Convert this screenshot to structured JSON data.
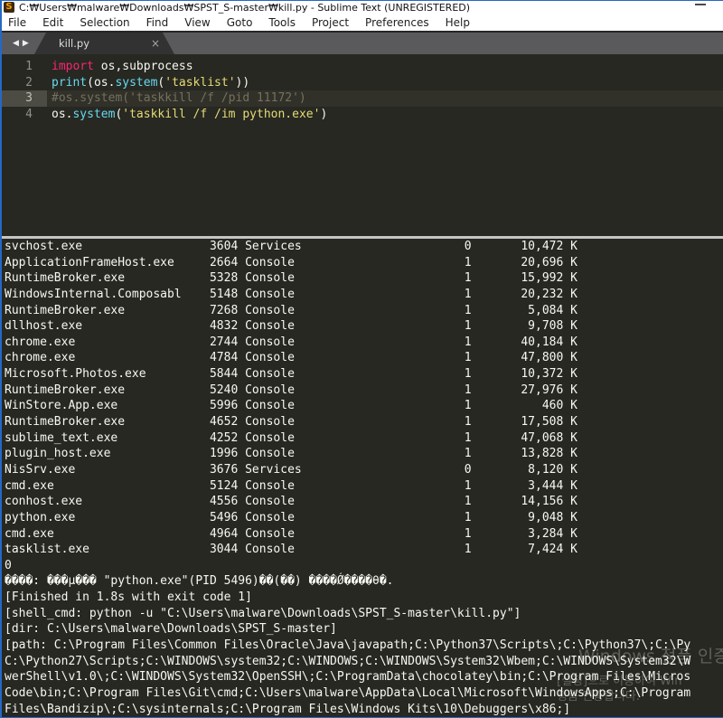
{
  "window": {
    "title": "C:₩Users₩malware₩Downloads₩SPST_S-master₩kill.py - Sublime Text (UNREGISTERED)",
    "app_icon": "S"
  },
  "menu": {
    "items": [
      "File",
      "Edit",
      "Selection",
      "Find",
      "View",
      "Goto",
      "Tools",
      "Project",
      "Preferences",
      "Help"
    ]
  },
  "tabbar": {
    "prev_icon": "◀",
    "next_icon": "▶",
    "tab": {
      "label": "kill.py",
      "close_icon": "×"
    }
  },
  "editor": {
    "lines": [
      {
        "number": "1",
        "highlight": false,
        "tokens": [
          {
            "t": "import",
            "c": "kw"
          },
          {
            "t": " os,subprocess",
            "c": "plain"
          }
        ]
      },
      {
        "number": "2",
        "highlight": false,
        "tokens": [
          {
            "t": "print",
            "c": "fn"
          },
          {
            "t": "(os.",
            "c": "plain"
          },
          {
            "t": "system",
            "c": "fn"
          },
          {
            "t": "(",
            "c": "plain"
          },
          {
            "t": "'tasklist'",
            "c": "str"
          },
          {
            "t": "))",
            "c": "plain"
          }
        ]
      },
      {
        "number": "3",
        "highlight": true,
        "tokens": [
          {
            "t": "#os.system('taskkill /f /pid 11172')",
            "c": "cmt"
          }
        ]
      },
      {
        "number": "4",
        "highlight": false,
        "tokens": [
          {
            "t": "os.",
            "c": "plain"
          },
          {
            "t": "system",
            "c": "fn"
          },
          {
            "t": "(",
            "c": "plain"
          },
          {
            "t": "'taskkill /f /im python.exe'",
            "c": "str"
          },
          {
            "t": ")",
            "c": "plain"
          }
        ]
      }
    ]
  },
  "console": {
    "processes": [
      {
        "name": "svchost.exe",
        "pid": "3604",
        "session": "Services",
        "session_no": "0",
        "mem": "10,472 K"
      },
      {
        "name": "ApplicationFrameHost.exe",
        "pid": "2664",
        "session": "Console",
        "session_no": "1",
        "mem": "20,696 K"
      },
      {
        "name": "RuntimeBroker.exe",
        "pid": "5328",
        "session": "Console",
        "session_no": "1",
        "mem": "15,992 K"
      },
      {
        "name": "WindowsInternal.Composabl",
        "pid": "5148",
        "session": "Console",
        "session_no": "1",
        "mem": "20,232 K"
      },
      {
        "name": "RuntimeBroker.exe",
        "pid": "7268",
        "session": "Console",
        "session_no": "1",
        "mem": "5,084 K"
      },
      {
        "name": "dllhost.exe",
        "pid": "4832",
        "session": "Console",
        "session_no": "1",
        "mem": "9,708 K"
      },
      {
        "name": "chrome.exe",
        "pid": "2744",
        "session": "Console",
        "session_no": "1",
        "mem": "40,184 K"
      },
      {
        "name": "chrome.exe",
        "pid": "4784",
        "session": "Console",
        "session_no": "1",
        "mem": "47,800 K"
      },
      {
        "name": "Microsoft.Photos.exe",
        "pid": "5844",
        "session": "Console",
        "session_no": "1",
        "mem": "10,372 K"
      },
      {
        "name": "RuntimeBroker.exe",
        "pid": "5240",
        "session": "Console",
        "session_no": "1",
        "mem": "27,976 K"
      },
      {
        "name": "WinStore.App.exe",
        "pid": "5996",
        "session": "Console",
        "session_no": "1",
        "mem": "460 K"
      },
      {
        "name": "RuntimeBroker.exe",
        "pid": "4652",
        "session": "Console",
        "session_no": "1",
        "mem": "17,508 K"
      },
      {
        "name": "sublime_text.exe",
        "pid": "4252",
        "session": "Console",
        "session_no": "1",
        "mem": "47,068 K"
      },
      {
        "name": "plugin_host.exe",
        "pid": "1996",
        "session": "Console",
        "session_no": "1",
        "mem": "13,828 K"
      },
      {
        "name": "NisSrv.exe",
        "pid": "3676",
        "session": "Services",
        "session_no": "0",
        "mem": "8,120 K"
      },
      {
        "name": "cmd.exe",
        "pid": "5124",
        "session": "Console",
        "session_no": "1",
        "mem": "3,444 K"
      },
      {
        "name": "conhost.exe",
        "pid": "4556",
        "session": "Console",
        "session_no": "1",
        "mem": "14,156 K"
      },
      {
        "name": "python.exe",
        "pid": "5496",
        "session": "Console",
        "session_no": "1",
        "mem": "9,048 K"
      },
      {
        "name": "cmd.exe",
        "pid": "4964",
        "session": "Console",
        "session_no": "1",
        "mem": "3,284 K"
      },
      {
        "name": "tasklist.exe",
        "pid": "3044",
        "session": "Console",
        "session_no": "1",
        "mem": "7,424 K"
      }
    ],
    "tail_lines": [
      "0",
      "����: ���µ��� \"python.exe\"(PID 5496)��(��) ����Ǿ����θ�.",
      "[Finished in 1.8s with exit code 1]",
      "[shell_cmd: python -u \"C:\\Users\\malware\\Downloads\\SPST_S-master\\kill.py\"]",
      "[dir: C:\\Users\\malware\\Downloads\\SPST_S-master]",
      "[path: C:\\Program Files\\Common Files\\Oracle\\Java\\javapath;C:\\Python37\\Scripts\\;C:\\Python37\\;C:\\Py",
      "C:\\Python27\\Scripts;C:\\WINDOWS\\system32;C:\\WINDOWS;C:\\WINDOWS\\System32\\Wbem;C:\\WINDOWS\\System32\\W",
      "werShell\\v1.0\\;C:\\WINDOWS\\System32\\OpenSSH\\;C:\\ProgramData\\chocolatey\\bin;C:\\Program Files\\Micros",
      "Code\\bin;C:\\Program Files\\Git\\cmd;C:\\Users\\malware\\AppData\\Local\\Microsoft\\WindowsApps;C:\\Program",
      "Files\\Bandizip\\;C:\\sysinternals;C:\\Program Files\\Windows Kits\\10\\Debuggers\\x86;]"
    ]
  },
  "watermark": {
    "title": "Windows 정품 인증",
    "body_line1": "[설정]으로 이동하여 Win",
    "body_line2": "정품 인증합니다."
  },
  "colors": {
    "accent_border": "#2668c5",
    "titlebar_bg": "#ffffff",
    "tabbar_bg": "#5a5a5c",
    "editor_bg": "#272822",
    "keyword": "#f92672",
    "function": "#66d9ef",
    "string": "#e6db74",
    "comment": "#75715e",
    "console_fg": "#f8f8f2",
    "splitter": "#c5c5c5"
  }
}
